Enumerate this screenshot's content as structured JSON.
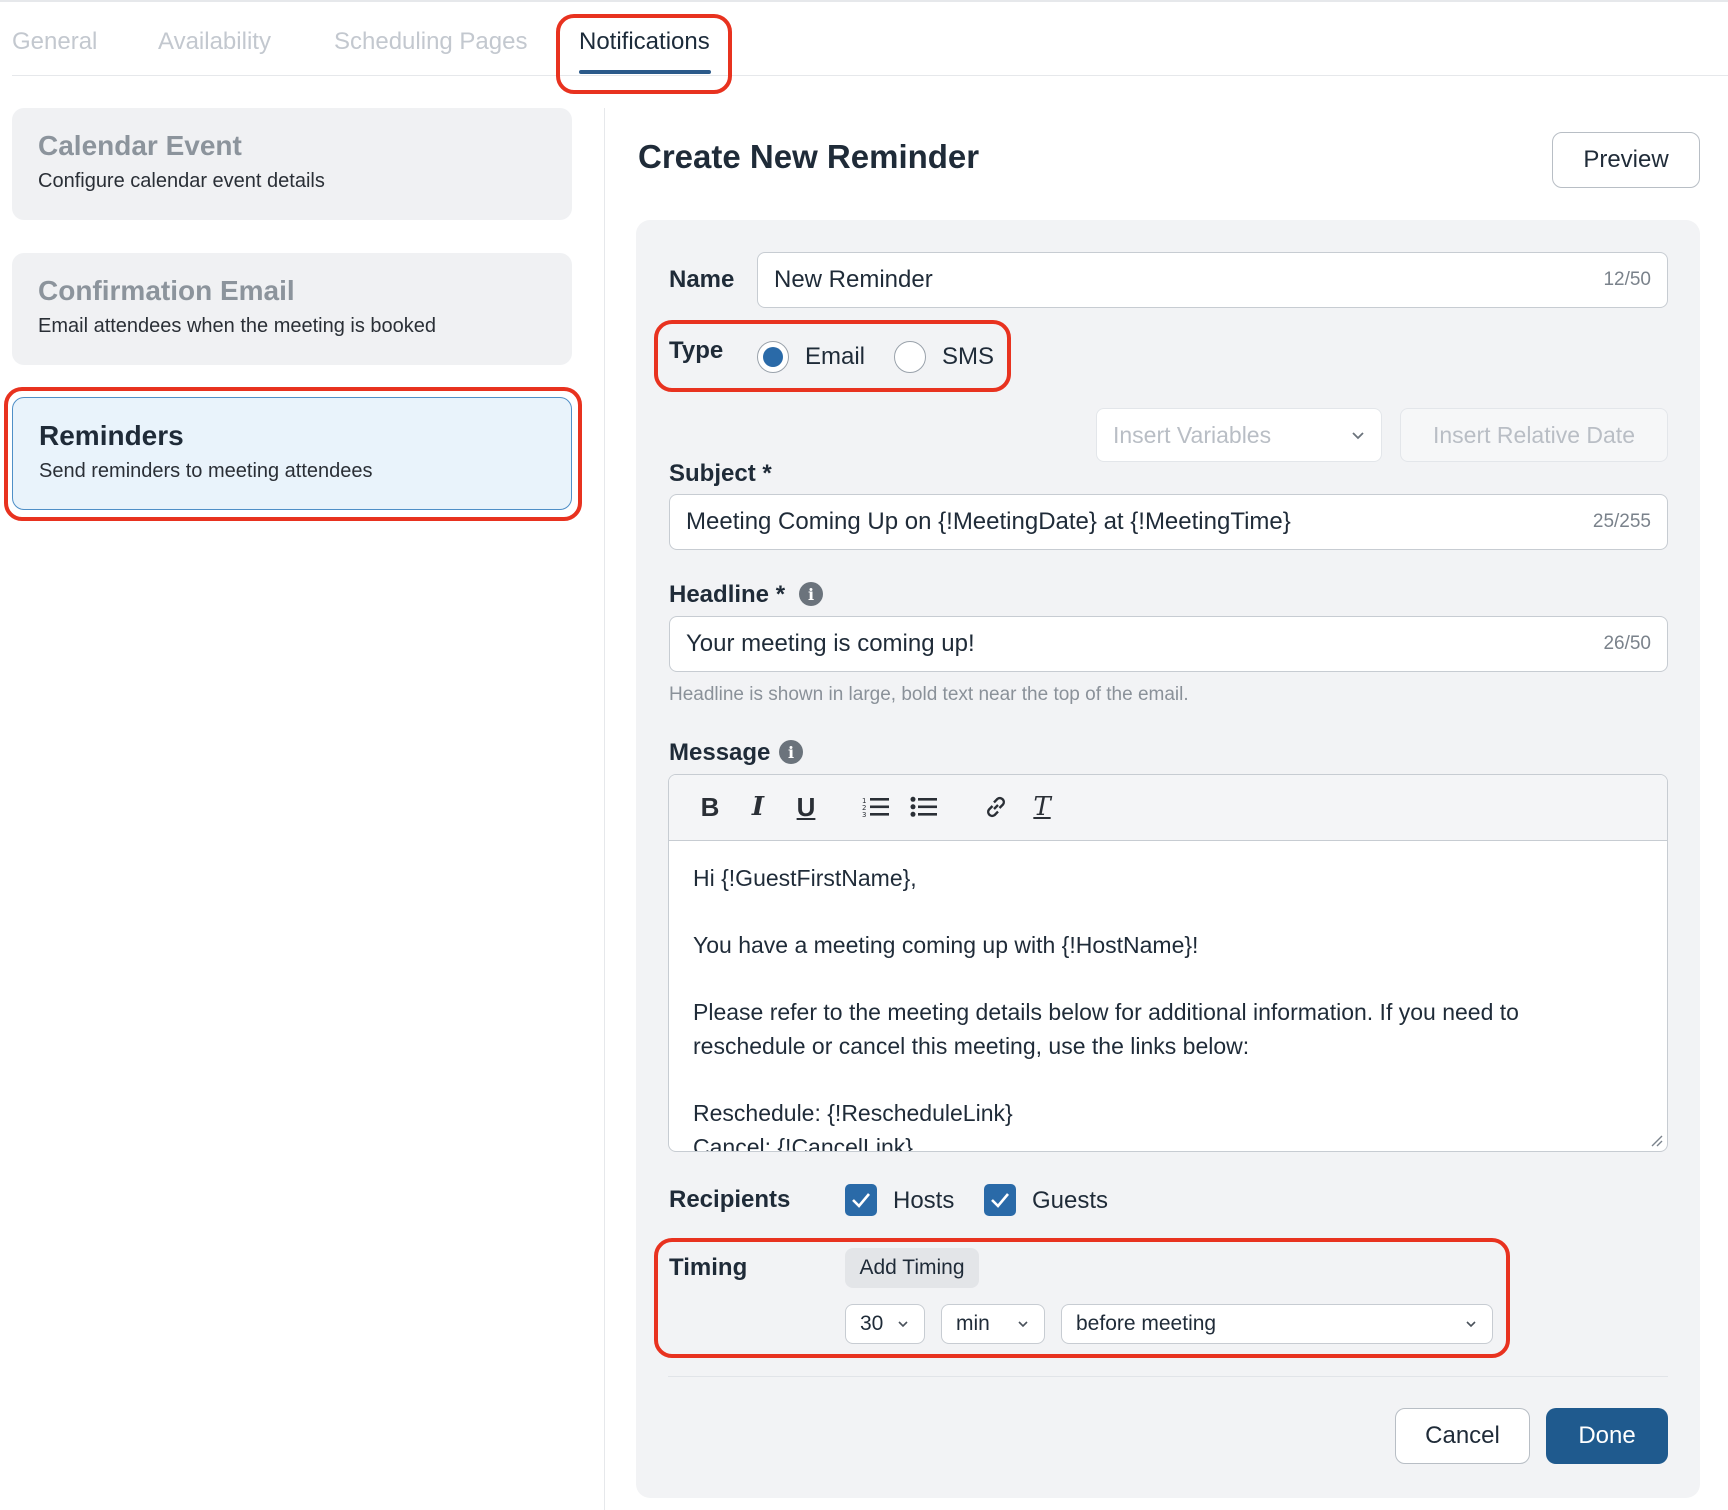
{
  "tabs": [
    {
      "label": "General"
    },
    {
      "label": "Availability"
    },
    {
      "label": "Scheduling Pages"
    },
    {
      "label": "Notifications"
    }
  ],
  "sidebar": {
    "cards": [
      {
        "title": "Calendar Event",
        "subtitle": "Configure calendar event details"
      },
      {
        "title": "Confirmation Email",
        "subtitle": "Email attendees when the meeting is booked"
      },
      {
        "title": "Reminders",
        "subtitle": "Send reminders to meeting attendees"
      }
    ]
  },
  "form": {
    "title": "Create New Reminder",
    "preview_label": "Preview",
    "name": {
      "label": "Name",
      "value": "New Reminder",
      "count": "12/50"
    },
    "type": {
      "label": "Type",
      "options": [
        "Email",
        "SMS"
      ],
      "selected": "Email"
    },
    "insert_variables": "Insert Variables",
    "insert_relative_date": "Insert Relative Date",
    "subject": {
      "label": "Subject *",
      "value": "Meeting Coming Up on {!MeetingDate} at {!MeetingTime}",
      "count": "25/255"
    },
    "headline": {
      "label": "Headline *",
      "value": "Your meeting is coming up!",
      "count": "26/50",
      "help": "Headline is shown in large, bold text near the top of the email."
    },
    "message": {
      "label": "Message",
      "toolbar": {
        "bold": "B",
        "italic": "I",
        "underline": "U",
        "clear_format": "T"
      },
      "lines": [
        "Hi {!GuestFirstName},",
        "You have a meeting coming up with {!HostName}!",
        "Please refer to the meeting details below for additional information. If you need to reschedule or cancel this meeting, use the links below:",
        "Reschedule: {!RescheduleLink}",
        "Cancel: {!CancelLink}"
      ]
    },
    "recipients": {
      "label": "Recipients",
      "hosts": "Hosts",
      "guests": "Guests",
      "hosts_checked": true,
      "guests_checked": true
    },
    "timing": {
      "label": "Timing",
      "add_label": "Add Timing",
      "amount": "30",
      "unit": "min",
      "relation": "before meeting"
    },
    "cancel_label": "Cancel",
    "done_label": "Done"
  },
  "colors": {
    "accent": "#1f5a8e",
    "highlight": "#e8321f",
    "selected_card": "#e9f3fb"
  }
}
